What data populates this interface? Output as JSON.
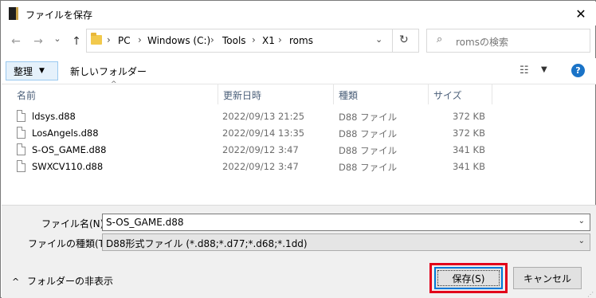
{
  "window": {
    "title": "ファイルを保存",
    "close_glyph": "✕"
  },
  "nav": {
    "back": "←",
    "forward": "→",
    "recent": "⌄",
    "up": "↑"
  },
  "address": {
    "path": [
      "PC",
      "Windows (C:)",
      "Tools",
      "X1",
      "roms"
    ],
    "separator": "›",
    "dropdown": "⌄",
    "refresh": "↻"
  },
  "search": {
    "placeholder": "romsの検索",
    "icon": "⌕"
  },
  "toolbar": {
    "organize": "整理",
    "organize_caret": "▼",
    "new_folder": "新しいフォルダー",
    "view_icon": "☷",
    "view_dropdown": "▼",
    "help": "?"
  },
  "columns": {
    "name": "名前",
    "date": "更新日時",
    "type": "種類",
    "size": "サイズ",
    "sort_arrow": "^"
  },
  "files": [
    {
      "name": "ldsys.d88",
      "date": "2022/09/13 21:25",
      "type": "D88 ファイル",
      "size": "372 KB"
    },
    {
      "name": "LosAngels.d88",
      "date": "2022/09/14 13:35",
      "type": "D88 ファイル",
      "size": "372 KB"
    },
    {
      "name": "S-OS_GAME.d88",
      "date": "2022/09/12 3:47",
      "type": "D88 ファイル",
      "size": "341 KB"
    },
    {
      "name": "SWXCV110.d88",
      "date": "2022/09/12 3:47",
      "type": "D88 ファイル",
      "size": "341 KB"
    }
  ],
  "form": {
    "filename_label": "ファイル名(N):",
    "filename_value": "S-OS_GAME.d88",
    "filetype_label": "ファイルの種類(T):",
    "filetype_value": "D88形式ファイル (*.d88;*.d77;*.d68;*.1dd)",
    "dropdown": "⌄"
  },
  "footer": {
    "hide_folders": "フォルダーの非表示",
    "hide_chevron": "^",
    "save": "保存(S)",
    "cancel": "キャンセル",
    "grip": "⋰"
  },
  "colors": {
    "accent": "#0078d7",
    "highlight": "#e2001a",
    "header_text": "#4c607a"
  }
}
